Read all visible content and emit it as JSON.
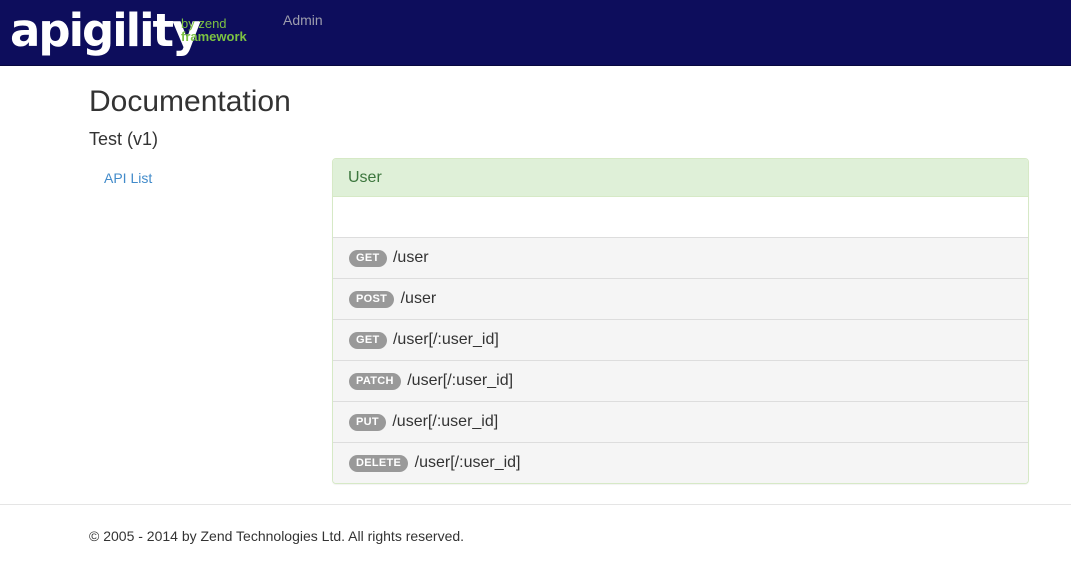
{
  "brand": {
    "main": "apigility",
    "sub_line1": "by zend",
    "sub_line2": "framework"
  },
  "nav": {
    "admin_label": "Admin"
  },
  "page": {
    "title": "Documentation",
    "subtitle": "Test (v1)"
  },
  "sidebar": {
    "api_list_label": "API List"
  },
  "panel": {
    "heading": "User",
    "operations": [
      {
        "method": "GET",
        "path": "/user"
      },
      {
        "method": "POST",
        "path": "/user"
      },
      {
        "method": "GET",
        "path": "/user[/:user_id]"
      },
      {
        "method": "PATCH",
        "path": "/user[/:user_id]"
      },
      {
        "method": "PUT",
        "path": "/user[/:user_id]"
      },
      {
        "method": "DELETE",
        "path": "/user[/:user_id]"
      }
    ]
  },
  "footer": {
    "text": "© 2005 - 2014 by Zend Technologies Ltd. All rights reserved."
  },
  "colors": {
    "navbar_bg": "#0d0d5c",
    "brand_accent": "#7cc242",
    "panel_heading_bg": "#dff0d8",
    "panel_heading_text": "#3c763d",
    "link": "#428bca",
    "badge_bg": "#999999"
  }
}
